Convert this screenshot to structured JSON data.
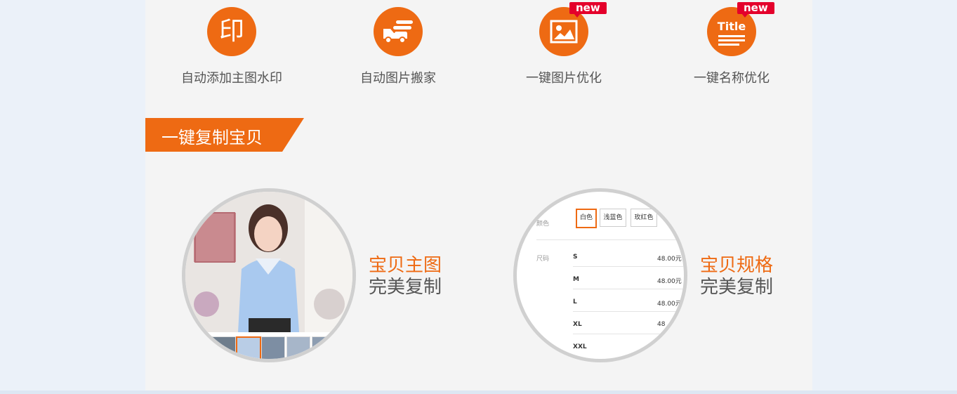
{
  "features": [
    {
      "label": "自动添加主图水印",
      "icon": "stamp-icon",
      "icon_text": "印",
      "badge": ""
    },
    {
      "label": "自动图片搬家",
      "icon": "truck-icon",
      "badge": ""
    },
    {
      "label": "一键图片优化",
      "icon": "image-icon",
      "badge": "new"
    },
    {
      "label": "一键名称优化",
      "icon": "title-icon",
      "icon_text": "Title",
      "badge": "new"
    }
  ],
  "section": {
    "title": "一键复制宝贝"
  },
  "showcase": [
    {
      "highlight": "宝贝主图",
      "subtitle": "完美复制"
    },
    {
      "highlight": "宝贝规格",
      "subtitle": "完美复制"
    }
  ],
  "spec_preview": {
    "color_label": "颜色",
    "colors": [
      "白色",
      "浅蓝色",
      "玫红色"
    ],
    "size_label": "尺码",
    "sizes": [
      {
        "size": "S",
        "price": "48.00元"
      },
      {
        "size": "M",
        "price": "48.00元"
      },
      {
        "size": "L",
        "price": "48.00元"
      },
      {
        "size": "XL",
        "price": "48"
      },
      {
        "size": "XXL",
        "price": ""
      }
    ]
  },
  "colors": {
    "accent": "#ee6a13",
    "badge": "#e4002b",
    "panel": "#f4f4f4",
    "page": "#ebf1f9"
  }
}
